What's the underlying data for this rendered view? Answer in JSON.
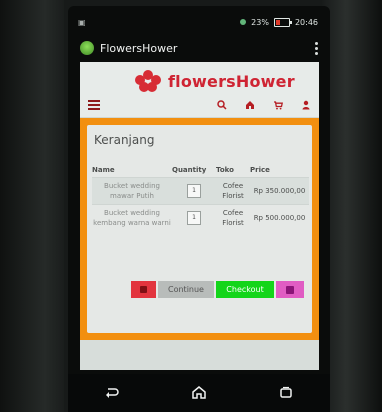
{
  "status_bar": {
    "time": "20:46",
    "battery": "23%"
  },
  "app_bar": {
    "title": "FlowersHower"
  },
  "site_header": {
    "logo_text": "flowersHower"
  },
  "cart": {
    "title": "Keranjang",
    "columns": [
      "Name",
      "Quantity",
      "Toko",
      "Price"
    ],
    "items": [
      {
        "name": "Bucket wedding mawar Putih",
        "quantity": "1",
        "shop": "Cofee Florist",
        "price": "Rp 350.000,00"
      },
      {
        "name": "Bucket wedding kembang warna warni",
        "quantity": "1",
        "shop": "Cofee Florist",
        "price": "Rp 500.000,00"
      }
    ],
    "buttons": {
      "continue": "Continue",
      "checkout": "Checkout"
    }
  },
  "colors": {
    "accent_orange": "#f28f10",
    "logo_red": "#cf2433",
    "checkout_green": "#13d51a",
    "delete_red": "#e2343e",
    "save_pink": "#e05cc3"
  },
  "icons": {
    "menu": "hamburger-icon",
    "search": "search-icon",
    "home": "home-icon",
    "cart": "cart-icon",
    "profile": "user-icon",
    "delete": "trash-icon",
    "save": "save-icon",
    "nav_back": "back-icon",
    "nav_home": "home-nav-icon",
    "nav_recent": "recent-apps-icon"
  }
}
